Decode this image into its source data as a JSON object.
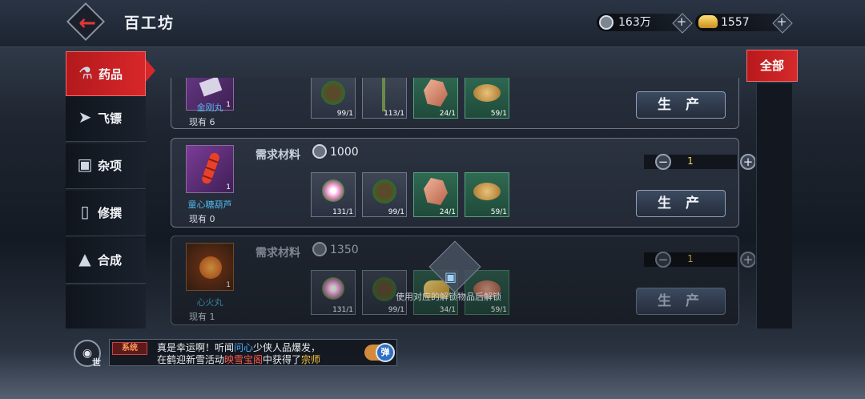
{
  "header": {
    "title": "百工坊",
    "silver": "163万",
    "gold": "1557"
  },
  "sidebar": {
    "items": [
      {
        "label": "药品",
        "icon": "medicine-bottle-icon"
      },
      {
        "label": "飞镖",
        "icon": "dart-icon"
      },
      {
        "label": "杂项",
        "icon": "chest-icon"
      },
      {
        "label": "修撰",
        "icon": "book-icon"
      },
      {
        "label": "合成",
        "icon": "anvil-icon"
      }
    ]
  },
  "filter": {
    "label": "全部"
  },
  "recipes": [
    {
      "name": "金刚丸",
      "owned": "现有 6",
      "count": "1",
      "materials": [
        "99/1",
        "113/1",
        "24/1",
        "59/1"
      ],
      "produce_label": "生 产"
    },
    {
      "name": "童心糖葫芦",
      "owned": "现有 0",
      "count": "1",
      "req_label": "需求材料",
      "cost": "1000",
      "qty": "1",
      "materials": [
        "131/1",
        "99/1",
        "24/1",
        "59/1"
      ],
      "produce_label": "生 产"
    },
    {
      "name": "心火丸",
      "owned": "现有 1",
      "count": "1",
      "req_label": "需求材料",
      "cost": "1350",
      "qty": "1",
      "materials": [
        "131/1",
        "99/1",
        "34/1",
        "59/1"
      ],
      "produce_label": "生 产",
      "lock_text": "使用对应的解锁物品后解锁"
    }
  ],
  "chat": {
    "channel_tag": "系统",
    "world_label": "世",
    "line1_a": "真是幸运啊！听闻",
    "line1_name": "问心",
    "line1_b": "少侠人品爆发，",
    "line2_a": "在鹤迎新雪活动",
    "line2_event": "映雪宝阁",
    "line2_b": "中获得了",
    "line2_item": "宗师",
    "toggle_label": "弹"
  },
  "colors": {
    "accent_red": "#d62a2c",
    "rarity_blue": "#4fb6e8",
    "qty_gold": "#f0d26a"
  }
}
